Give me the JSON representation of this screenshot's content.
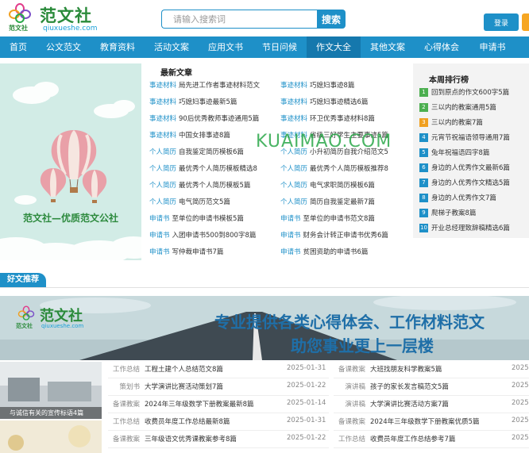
{
  "header": {
    "logo_small": "范文社",
    "logo_big": "范文社",
    "logo_url": "qiuxueshe.com",
    "search_placeholder": "请输入搜索词",
    "search_button": "搜索",
    "login_button": "登录"
  },
  "nav": {
    "items": [
      "首页",
      "公文范文",
      "教育资料",
      "活动文案",
      "应用文书",
      "节日问候",
      "作文大全",
      "其他文案",
      "心得体会",
      "申请书"
    ],
    "active_index": 6
  },
  "banner": {
    "caption": "范文社—优质范文公社"
  },
  "latest": {
    "title": "最新文章",
    "left": [
      {
        "cat": "事迹材料",
        "title": "局先进工作者事迹材料范文"
      },
      {
        "cat": "事迹材料",
        "title": "巧媳妇事迹最新5篇"
      },
      {
        "cat": "事迹材料",
        "title": "90后优秀教师事迹通用5篇"
      },
      {
        "cat": "事迹材料",
        "title": "中国女排事迹8篇"
      },
      {
        "cat": "个人简历",
        "title": "自我鉴定简历模板6篇"
      },
      {
        "cat": "个人简历",
        "title": "最优秀个人简历模板精选8"
      },
      {
        "cat": "个人简历",
        "title": "最优秀个人简历模板5篇"
      },
      {
        "cat": "个人简历",
        "title": "电气简历范文5篇"
      },
      {
        "cat": "申请书",
        "title": "至单位的申请书模板5篇"
      },
      {
        "cat": "申请书",
        "title": "入团申请书500到800字8篇"
      },
      {
        "cat": "申请书",
        "title": "写仲裁申请书7篇"
      }
    ],
    "right": [
      {
        "cat": "事迹材料",
        "title": "巧媳妇事迹8篇"
      },
      {
        "cat": "事迹材料",
        "title": "巧媳妇事迹精选6篇"
      },
      {
        "cat": "事迹材料",
        "title": "环卫优秀事迹材料8篇"
      },
      {
        "cat": "事迹材料",
        "title": "省级三好学生主要事迹5篇"
      },
      {
        "cat": "个人简历",
        "title": "小升初简历自我介绍范文5"
      },
      {
        "cat": "个人简历",
        "title": "最优秀个人简历模板推荐8"
      },
      {
        "cat": "个人简历",
        "title": "电气求职简历模板6篇"
      },
      {
        "cat": "个人简历",
        "title": "简历自我鉴定最新7篇"
      },
      {
        "cat": "申请书",
        "title": "至单位的申请书范文8篇"
      },
      {
        "cat": "申请书",
        "title": "财务会计转正申请书优秀6篇"
      },
      {
        "cat": "申请书",
        "title": "贫困资助的申请书6篇"
      }
    ]
  },
  "ranking": {
    "title": "本周排行榜",
    "items": [
      {
        "num": "1",
        "title": "回到原点的作文600字5篇",
        "color": "#4caf50"
      },
      {
        "num": "2",
        "title": "三以内的教案通用5篇",
        "color": "#4caf50"
      },
      {
        "num": "3",
        "title": "三以内的教案7篇",
        "color": "#f0a020"
      },
      {
        "num": "4",
        "title": "元宵节祝福语领导通用7篇",
        "color": "#1e90c8"
      },
      {
        "num": "5",
        "title": "兔年祝福语四字8篇",
        "color": "#1e90c8"
      },
      {
        "num": "6",
        "title": "身边的人优秀作文最新6篇",
        "color": "#1e90c8"
      },
      {
        "num": "7",
        "title": "身边的人优秀作文精选5篇",
        "color": "#1e90c8"
      },
      {
        "num": "8",
        "title": "身边的人优秀作文7篇",
        "color": "#1e90c8"
      },
      {
        "num": "9",
        "title": "爬梯子教案8篇",
        "color": "#1e90c8"
      },
      {
        "num": "10",
        "title": "开业总经理致辞稿精选6篇",
        "color": "#1e90c8"
      }
    ]
  },
  "watermark": "KUAIMAO.COM",
  "recommend": {
    "tag": "好文推荐"
  },
  "promo": {
    "logo_big": "范文社",
    "logo_small": "范文社",
    "logo_url": "qiuxueshe.com",
    "line1": "专业提供各类心得体会、工作材料范文",
    "line2": "助您事业更上一层楼"
  },
  "thumbs": {
    "caption1": "与诚信有关的宣传标语4篇"
  },
  "bottom_list": {
    "left": [
      {
        "cat": "工作总结",
        "title": "工程土建个人总结范文8篇",
        "date": "2025-01-31"
      },
      {
        "cat": "策划书",
        "title": "大学演讲比赛活动策划7篇",
        "date": "2025-01-22"
      },
      {
        "cat": "备课教案",
        "title": "2024年三年级数学下册教案最新8篇",
        "date": "2025-01-14"
      },
      {
        "cat": "工作总结",
        "title": "收费员年度工作总结最新8篇",
        "date": "2025-01-31"
      },
      {
        "cat": "备课教案",
        "title": "三年级语文优秀课教案参考8篇",
        "date": "2025-01-22"
      }
    ],
    "right": [
      {
        "cat": "备课教案",
        "title": "大班找朋友科学教案5篇",
        "date": "2025"
      },
      {
        "cat": "演讲稿",
        "title": "孩子的家长发言稿范文5篇",
        "date": "2025"
      },
      {
        "cat": "演讲稿",
        "title": "大学演讲比赛活动方案7篇",
        "date": "2025"
      },
      {
        "cat": "备课教案",
        "title": "2024年三年级数学下册教案优质5篇",
        "date": "2025"
      },
      {
        "cat": "工作总结",
        "title": "收费员年度工作总结参考7篇",
        "date": "2025"
      }
    ]
  }
}
